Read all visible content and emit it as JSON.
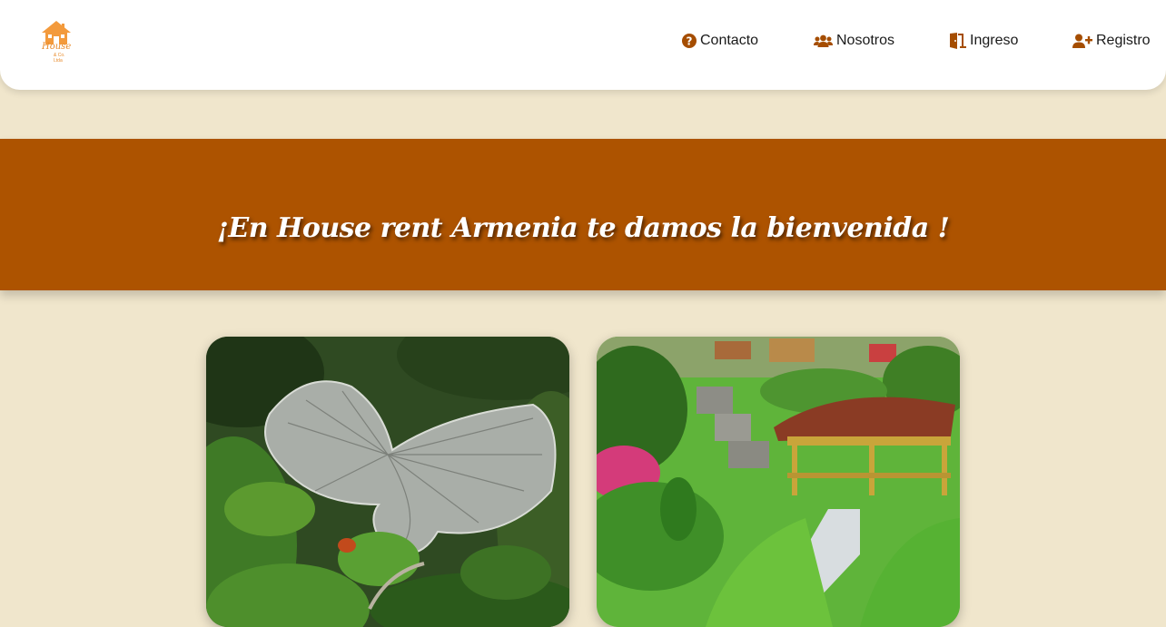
{
  "brand": {
    "logo_text": "House",
    "logo_subtext": "& Co. Ltda",
    "accent_color": "#e88a2a"
  },
  "nav": {
    "items": [
      {
        "label": "Contacto",
        "icon": "question-circle-icon"
      },
      {
        "label": "Nosotros",
        "icon": "users-icon"
      },
      {
        "label": "Ingreso",
        "icon": "door-open-icon"
      },
      {
        "label": "Registro",
        "icon": "user-plus-icon"
      }
    ],
    "icon_color": "#a54d00"
  },
  "banner": {
    "title": "¡En House rent Armenia te damos la bienvenida !",
    "background": "#ad5300"
  },
  "cards": [
    {
      "image": "butterfly-garden-greenhouse-photo"
    },
    {
      "image": "park-waterfall-gazebo-photo"
    }
  ],
  "page": {
    "background": "#f0e6cc"
  }
}
